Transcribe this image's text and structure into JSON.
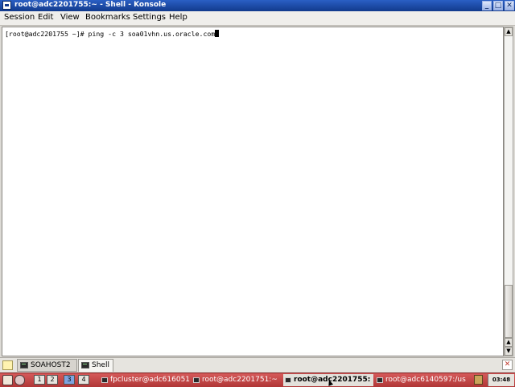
{
  "window": {
    "title": "root@adc2201755:~ - Shell - Konsole",
    "buttons": {
      "minimize": "_",
      "maximize": "□",
      "close": "✕"
    }
  },
  "menu": [
    "Session",
    "Edit",
    "View",
    "Bookmarks",
    "Settings",
    "Help"
  ],
  "terminal": {
    "prompt": "[root@adc2201755 ~]#",
    "command": " ping -c 3 soa01vhn.us.oracle.com"
  },
  "tabs": [
    {
      "label": "SOAHOST2",
      "active": false
    },
    {
      "label": "Shell",
      "active": true
    }
  ],
  "taskbar": {
    "desktops": [
      "1",
      "2",
      "3",
      "4"
    ],
    "tasks": [
      {
        "label": "fpcluster@adc616051",
        "active": false
      },
      {
        "label": "root@adc2201751:~",
        "active": false
      },
      {
        "label": "root@adc2201755:",
        "active": true
      },
      {
        "label": "root@adc6140597:/us",
        "active": false
      }
    ],
    "clock": "03:48"
  },
  "icons": {
    "app": "konsole-icon",
    "new_tab": "new-tab-icon",
    "close_tab": "close-tab-icon",
    "tab": "terminal-icon"
  }
}
